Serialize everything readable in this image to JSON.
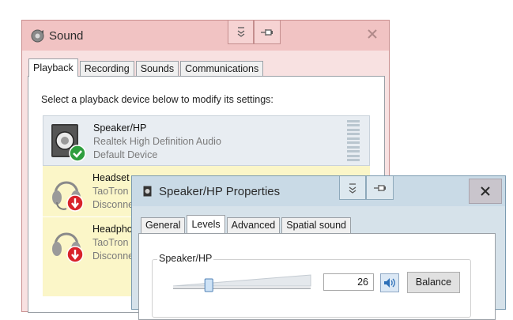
{
  "sound_window": {
    "title": "Sound",
    "tabs": [
      "Playback",
      "Recording",
      "Sounds",
      "Communications"
    ],
    "active_tab": "Playback",
    "instruction": "Select a playback device below to modify its settings:",
    "devices": [
      {
        "name": "Speaker/HP",
        "driver": "Realtek High Definition Audio",
        "status": "Default Device",
        "icon": "speaker-icon",
        "badge": "check-badge-icon"
      },
      {
        "name": "Headset",
        "driver": "TaoTron",
        "status": "Disconne",
        "icon": "headset-icon",
        "badge": "down-arrow-badge-icon"
      },
      {
        "name": "Headpho",
        "driver": "TaoTron",
        "status": "Disconne",
        "icon": "headphones-icon",
        "badge": "down-arrow-badge-icon"
      }
    ]
  },
  "properties_window": {
    "title": "Speaker/HP Properties",
    "tabs": [
      "General",
      "Levels",
      "Advanced",
      "Spatial sound"
    ],
    "active_tab": "Levels",
    "group_label": "Speaker/HP",
    "volume": "26",
    "volume_fraction": 0.26,
    "balance_label": "Balance"
  },
  "colors": {
    "sound_title": "#f1c3c3",
    "props_title": "#c9dae6",
    "default_check": "#2e9e3e",
    "disconnected_badge": "#d8232a"
  }
}
